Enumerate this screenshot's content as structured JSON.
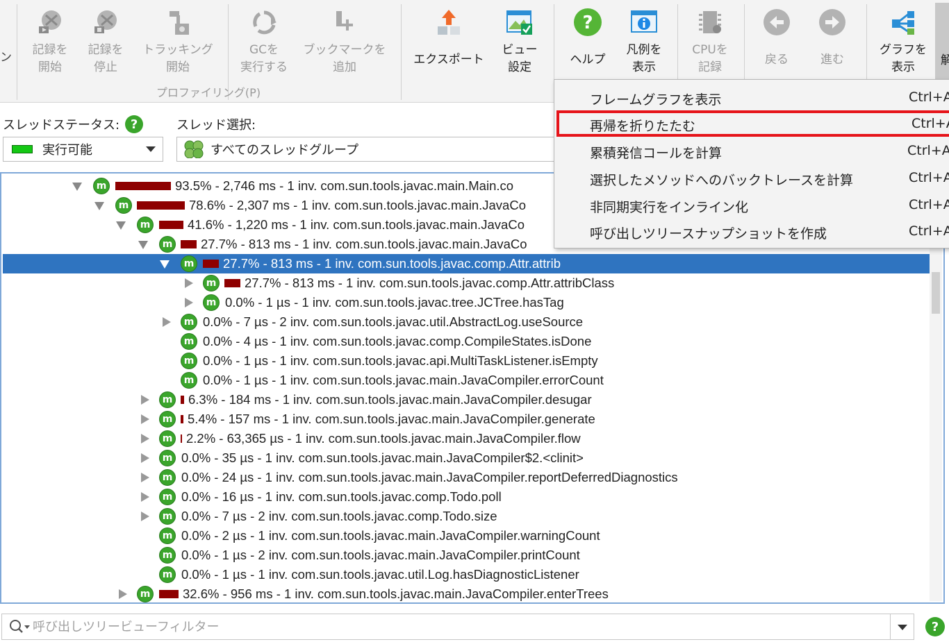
{
  "toolbar": {
    "edge_fragment": "ン",
    "right_fragment": "解",
    "group_label": "プロファイリング(P)",
    "buttons": [
      {
        "label": "記録を\n開始",
        "icon": "record-start-icon"
      },
      {
        "label": "記録を\n停止",
        "icon": "record-stop-icon"
      },
      {
        "label": "トラッキング\n開始",
        "icon": "tracking-start-icon"
      },
      {
        "label": "GCを\n実行する",
        "icon": "gc-icon"
      },
      {
        "label": "ブックマークを\n追加",
        "icon": "bookmark-add-icon"
      },
      {
        "label": "エクスポート",
        "icon": "export-icon"
      },
      {
        "label": "ビュー\n設定",
        "icon": "view-settings-icon"
      },
      {
        "label": "ヘルプ",
        "icon": "help-icon"
      },
      {
        "label": "凡例を\n表示",
        "icon": "legend-icon"
      },
      {
        "label": "CPUを\n記録",
        "icon": "cpu-icon"
      },
      {
        "label": "戻る",
        "icon": "back-icon"
      },
      {
        "label": "進む",
        "icon": "forward-icon"
      },
      {
        "label": "グラフを\n表示",
        "icon": "graph-icon"
      }
    ]
  },
  "thread": {
    "status_label": "スレッドステータス:",
    "status_value": "実行可能",
    "select_label": "スレッド選択:",
    "select_value": "すべてのスレッドグループ"
  },
  "tree": {
    "rows": [
      {
        "text": "93.5% - 2,746 ms - 1 inv. com.sun.tools.javac.main.Main.co",
        "pct": 93.5
      },
      {
        "text": "78.6% - 2,307 ms - 1 inv. com.sun.tools.javac.main.JavaCo",
        "pct": 78.6
      },
      {
        "text": "41.6% - 1,220 ms - 1 inv. com.sun.tools.javac.main.JavaCo",
        "pct": 41.6
      },
      {
        "text": "27.7% - 813 ms - 1 inv. com.sun.tools.javac.main.JavaCo",
        "pct": 27.7
      },
      {
        "text": "27.7% - 813 ms - 1 inv. com.sun.tools.javac.comp.Attr.attrib",
        "pct": 27.7
      },
      {
        "text": "27.7% - 813 ms - 1 inv. com.sun.tools.javac.comp.Attr.attribClass",
        "pct": 27.7
      },
      {
        "text": "0.0% - 1 µs - 1 inv. com.sun.tools.javac.tree.JCTree.hasTag",
        "pct": 0
      },
      {
        "text": "0.0% - 7 µs - 2 inv. com.sun.tools.javac.util.AbstractLog.useSource",
        "pct": 0
      },
      {
        "text": "0.0% - 4 µs - 1 inv. com.sun.tools.javac.comp.CompileStates.isDone",
        "pct": 0
      },
      {
        "text": "0.0% - 1 µs - 1 inv. com.sun.tools.javac.api.MultiTaskListener.isEmpty",
        "pct": 0
      },
      {
        "text": "0.0% - 1 µs - 1 inv. com.sun.tools.javac.main.JavaCompiler.errorCount",
        "pct": 0
      },
      {
        "text": "6.3% - 184 ms - 1 inv. com.sun.tools.javac.main.JavaCompiler.desugar",
        "pct": 6.3
      },
      {
        "text": "5.4% - 157 ms - 1 inv. com.sun.tools.javac.main.JavaCompiler.generate",
        "pct": 5.4
      },
      {
        "text": "2.2% - 63,365 µs - 1 inv. com.sun.tools.javac.main.JavaCompiler.flow",
        "pct": 2.2
      },
      {
        "text": "0.0% - 35 µs - 1 inv. com.sun.tools.javac.main.JavaCompiler$2.<clinit>",
        "pct": 0
      },
      {
        "text": "0.0% - 24 µs - 1 inv. com.sun.tools.javac.main.JavaCompiler.reportDeferredDiagnostics",
        "pct": 0
      },
      {
        "text": "0.0% - 16 µs - 1 inv. com.sun.tools.javac.comp.Todo.poll",
        "pct": 0
      },
      {
        "text": "0.0% - 7 µs - 2 inv. com.sun.tools.javac.comp.Todo.size",
        "pct": 0
      },
      {
        "text": "0.0% - 2 µs - 1 inv. com.sun.tools.javac.main.JavaCompiler.warningCount",
        "pct": 0
      },
      {
        "text": "0.0% - 1 µs - 2 inv. com.sun.tools.javac.main.JavaCompiler.printCount",
        "pct": 0
      },
      {
        "text": "0.0% - 1 µs - 1 inv. com.sun.tools.javac.util.Log.hasDiagnosticListener",
        "pct": 0
      },
      {
        "text": "32.6% - 956 ms - 1 inv. com.sun.tools.javac.main.JavaCompiler.enterTrees",
        "pct": 32.6
      }
    ]
  },
  "menu": {
    "items": [
      {
        "label": "フレームグラフを表示",
        "shortcut": "Ctrl+A"
      },
      {
        "label": "再帰を折りたたむ",
        "shortcut": "Ctrl+A"
      },
      {
        "label": "累積発信コールを計算",
        "shortcut": "Ctrl+A"
      },
      {
        "label": "選択したメソッドへのバックトレースを計算",
        "shortcut": "Ctrl+A"
      },
      {
        "label": "非同期実行をインライン化",
        "shortcut": "Ctrl+A"
      },
      {
        "label": "呼び出しツリースナップショットを作成",
        "shortcut": "Ctrl+A"
      }
    ]
  },
  "filter": {
    "placeholder": "呼び出しツリービューフィルター"
  },
  "colors": {
    "selection": "#2f74c0",
    "bar": "#8e0000",
    "method_icon": "#3aa52b",
    "highlight_border": "#e6141a"
  }
}
